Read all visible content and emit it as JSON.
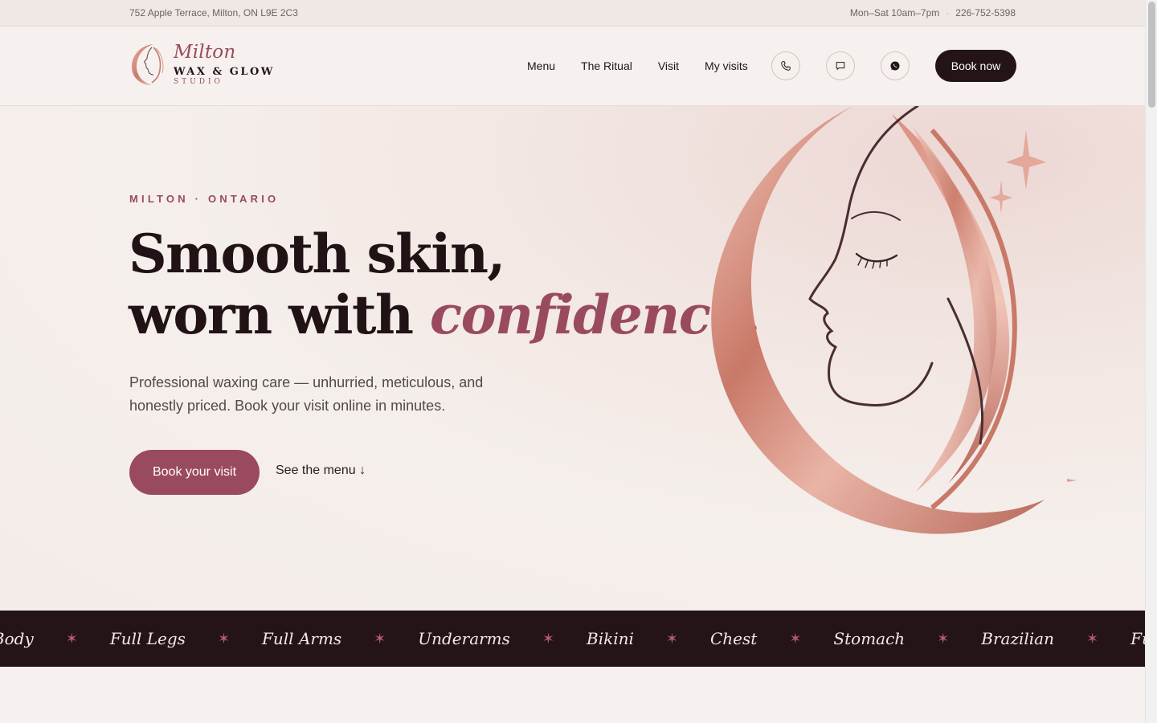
{
  "topbar": {
    "address": "752 Apple Terrace, Milton, ON L9E 2C3",
    "hours": "Mon–Sat 10am–7pm",
    "separator": "·",
    "phone": "226-752-5398"
  },
  "brand": {
    "script": "Milton",
    "main": "WAX & GLOW",
    "sub": "STUDIO"
  },
  "nav": {
    "items": [
      "Menu",
      "The Ritual",
      "Visit",
      "My visits"
    ],
    "icons": [
      "phone-icon",
      "message-icon",
      "whatsapp-icon"
    ],
    "book_label": "Book now"
  },
  "hero": {
    "eyebrow": "MILTON · ONTARIO",
    "headline_line1": "Smooth skin,",
    "headline_line2_start": "worn with ",
    "headline_accent": "confidence.",
    "lede": "Professional waxing care — unhurried, meticulous, and honestly priced. Book your visit online in minutes.",
    "primary_cta": "Book your visit",
    "secondary_cta": "See the menu ↓"
  },
  "marquee": {
    "items": [
      "Full Body",
      "Full Legs",
      "Full Arms",
      "Underarms",
      "Bikini",
      "Chest",
      "Stomach",
      "Brazilian",
      "Full Body"
    ],
    "separator": "✶"
  },
  "colors": {
    "accent": "#9a4a5f",
    "dark": "#241418",
    "background": "#f6f0ec",
    "rose_gold": "#d9958a"
  }
}
